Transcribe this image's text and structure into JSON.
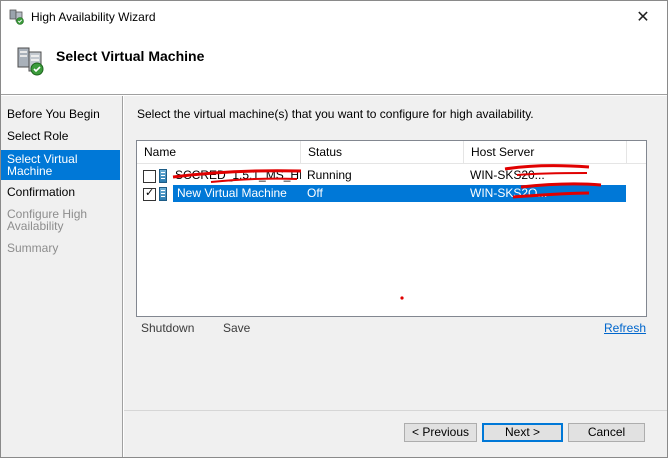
{
  "window": {
    "title": "High Availability Wizard",
    "close_glyph": "✕"
  },
  "header": {
    "title": "Select Virtual Machine"
  },
  "nav": {
    "items": [
      {
        "label": "Before You Begin",
        "state": "normal"
      },
      {
        "label": "Select Role",
        "state": "normal"
      },
      {
        "label": "Select Virtual Machine",
        "state": "selected"
      },
      {
        "label": "Confirmation",
        "state": "normal"
      },
      {
        "label": "Configure High Availability",
        "state": "disabled"
      },
      {
        "label": "Summary",
        "state": "disabled"
      }
    ]
  },
  "main": {
    "instruction": "Select the virtual machine(s) that you want to configure for high availability.",
    "columns": [
      "Name",
      "Status",
      "Host Server"
    ],
    "rows": [
      {
        "name": "SCCRED_1.5.1_MS_HIT...",
        "status": "Running",
        "host": "WIN-SKS20...",
        "checked": false,
        "selected": false
      },
      {
        "name": "New Virtual Machine",
        "status": "Off",
        "host": "WIN-SKS2O...",
        "checked": true,
        "selected": true
      }
    ],
    "actions": {
      "shutdown": "Shutdown",
      "save": "Save",
      "refresh": "Refresh"
    }
  },
  "footer": {
    "previous": "< Previous",
    "next": "Next >",
    "cancel": "Cancel"
  },
  "colors": {
    "selection": "#0078d7",
    "link": "#0066cc",
    "redaction": "#e00000"
  },
  "icons": {
    "app": "cluster-wizard-icon",
    "header": "cluster-server-icon",
    "vm": "virtual-machine-icon",
    "check": "checkmark-icon"
  }
}
